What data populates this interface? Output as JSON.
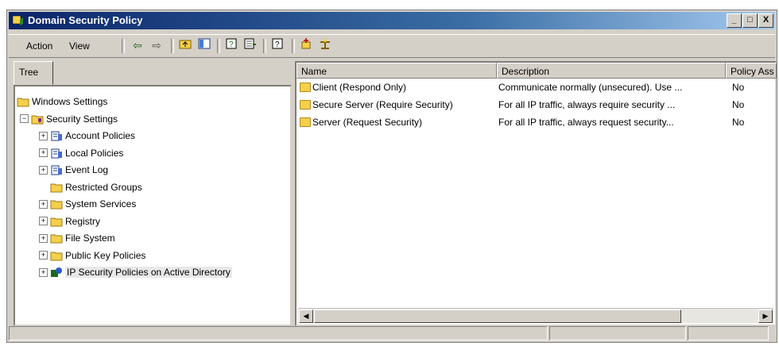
{
  "window": {
    "title": "Domain Security Policy",
    "minimize": "_",
    "maximize": "□",
    "close": "X"
  },
  "menu": [
    {
      "label": "Action"
    },
    {
      "label": "View"
    }
  ],
  "toolbar": [
    {
      "icon": "back-arrow-icon"
    },
    {
      "icon": "forward-arrow-icon"
    },
    {
      "icon": "up-folder-icon"
    },
    {
      "icon": "show-hide-tree-icon"
    },
    {
      "icon": "properties-icon"
    },
    {
      "icon": "export-list-icon"
    },
    {
      "icon": "help-icon"
    },
    {
      "icon": "add-policy-icon"
    },
    {
      "icon": "manage-filters-icon"
    }
  ],
  "left_tab": {
    "label": "Tree"
  },
  "tree": [
    {
      "label": "Windows Settings",
      "level": 0,
      "expander": "",
      "icon": "folder-icon"
    },
    {
      "label": "Security Settings",
      "level": 1,
      "expander": "−",
      "icon": "security-settings-icon"
    },
    {
      "label": "Account Policies",
      "level": 2,
      "expander": "+",
      "icon": "policy-icon"
    },
    {
      "label": "Local Policies",
      "level": 2,
      "expander": "+",
      "icon": "policy-icon"
    },
    {
      "label": "Event Log",
      "level": 2,
      "expander": "+",
      "icon": "policy-icon"
    },
    {
      "label": "Restricted Groups",
      "level": 2,
      "expander": "",
      "icon": "folder-icon"
    },
    {
      "label": "System Services",
      "level": 2,
      "expander": "+",
      "icon": "folder-icon"
    },
    {
      "label": "Registry",
      "level": 2,
      "expander": "+",
      "icon": "folder-icon"
    },
    {
      "label": "File System",
      "level": 2,
      "expander": "+",
      "icon": "folder-icon"
    },
    {
      "label": "Public Key Policies",
      "level": 2,
      "expander": "+",
      "icon": "folder-icon"
    },
    {
      "label": "IP Security Policies on Active Directory",
      "level": 2,
      "expander": "+",
      "icon": "network-policy-icon",
      "selected": true
    }
  ],
  "columns": [
    {
      "label": "Name"
    },
    {
      "label": "Description"
    },
    {
      "label": "Policy Ass"
    }
  ],
  "rows": [
    {
      "name": "Client (Respond Only)",
      "description": "Communicate normally (unsecured). Use ...",
      "assigned": "No"
    },
    {
      "name": "Secure Server (Require Security)",
      "description": "For all IP traffic, always require security ...",
      "assigned": "No"
    },
    {
      "name": "Server (Request Security)",
      "description": "For all IP traffic, always request security...",
      "assigned": "No"
    }
  ],
  "scrollbar": {
    "left": "◀",
    "right": "▶"
  },
  "colors": {
    "title_start": "#0a246a",
    "title_end": "#a6caf0",
    "chrome": "#d4d0c8",
    "folder": "#f5d04a",
    "selected": "#e8e8e8"
  }
}
